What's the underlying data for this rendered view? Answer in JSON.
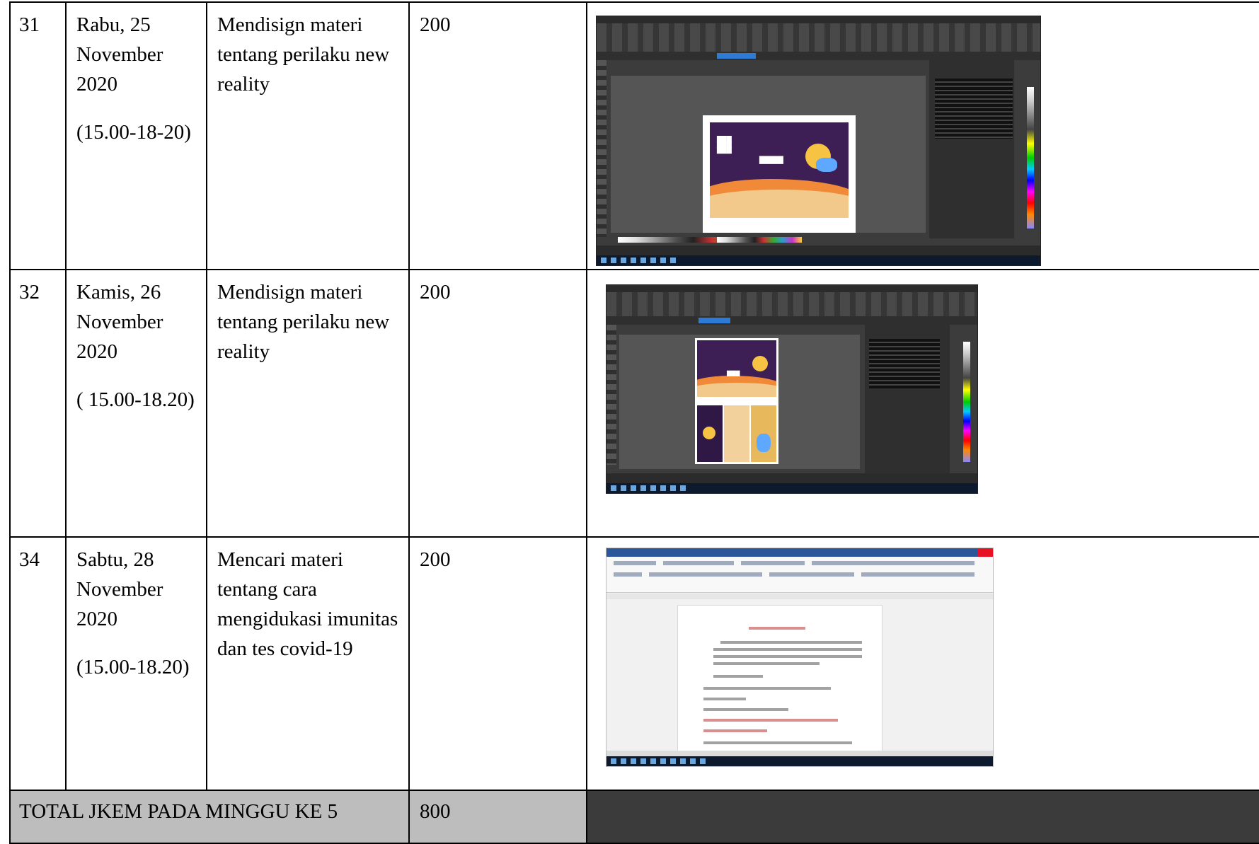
{
  "rows": [
    {
      "no": "31",
      "day": "Rabu, 25 November 2020",
      "time": "(15.00-18-20)",
      "activity": "Mendisign materi tentang perilaku new reality",
      "jkem": "200",
      "screenshot_icon": "coreldraw-screenshot"
    },
    {
      "no": "32",
      "day": "Kamis, 26 November 2020",
      "time": "( 15.00-18.20)",
      "activity": "Mendisign materi tentang perilaku new reality",
      "jkem": "200",
      "screenshot_icon": "coreldraw-screenshot"
    },
    {
      "no": "34",
      "day": "Sabtu, 28 November 2020",
      "time": "(15.00-18.20)",
      "activity": "Mencari materi tentang cara mengidukasi imunitas dan tes covid-19",
      "jkem": "200",
      "screenshot_icon": "word-document-screenshot"
    }
  ],
  "total": {
    "label": "TOTAL JKEM PADA MINGGU KE 5",
    "value": "800"
  },
  "colors": {
    "total_row": "#bdbdbd",
    "total_row_right": "#3b3b3b",
    "corel_ui": "#3c3c3c",
    "design_purple": "#3d1f56",
    "word_title": "#2b579a"
  }
}
